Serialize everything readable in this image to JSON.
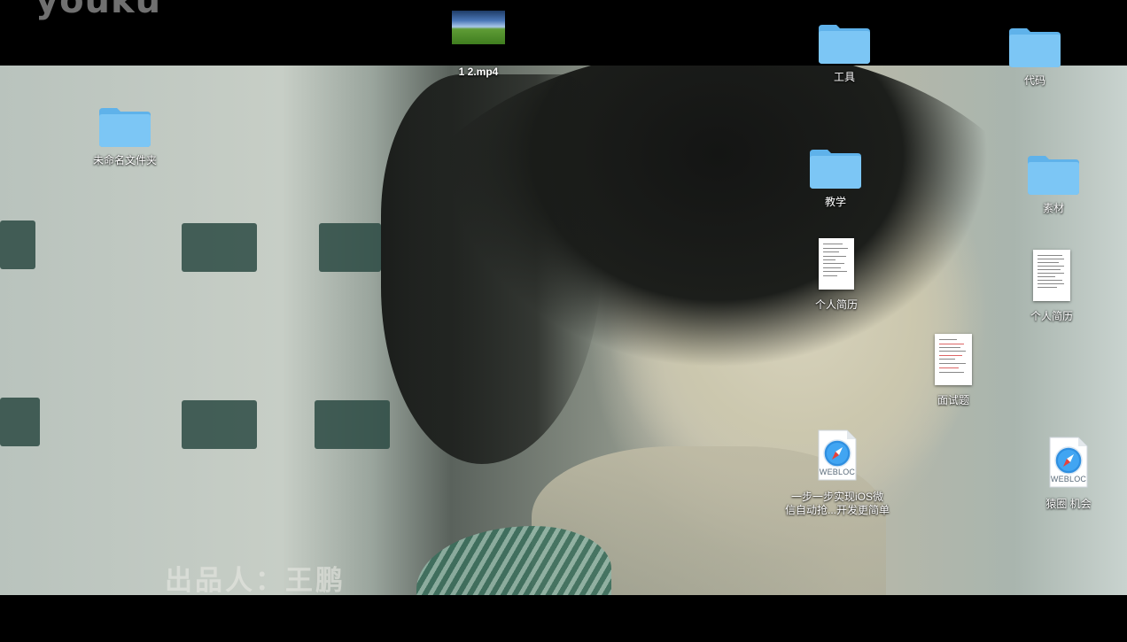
{
  "wallpaper": {
    "watermark": "youku",
    "credit_text": "出品人：王鹏"
  },
  "colors": {
    "folder_body": "#7cc6f5",
    "folder_tab": "#5fb2ea",
    "label_text": "#ffffff",
    "letterbox": "#000000"
  },
  "icons": {
    "video": {
      "label": "1 2.mp4",
      "icon": "video-thumbnail-icon"
    },
    "folder_tools": {
      "label": "工具",
      "icon": "folder-icon"
    },
    "folder_code": {
      "label": "代码",
      "icon": "folder-icon"
    },
    "folder_untitled": {
      "label": "未命名文件夹",
      "icon": "folder-icon"
    },
    "folder_teaching": {
      "label": "教学",
      "icon": "folder-icon"
    },
    "folder_materials": {
      "label": "素材",
      "icon": "folder-icon"
    },
    "resume_1": {
      "label": "个人简历",
      "icon": "document-icon"
    },
    "resume_2": {
      "label": "个人简历",
      "icon": "document-icon"
    },
    "interview": {
      "label": "面试题",
      "icon": "document-icon"
    },
    "webloc_ios": {
      "label_line1": "一步一步实现iOS微",
      "label_line2": "信自动抢...开发更简单",
      "badge": "WEBLOC",
      "icon": "safari-compass-icon"
    },
    "webloc_jobs": {
      "label": "猿圈 机会",
      "badge": "WEBLOC",
      "icon": "safari-compass-icon"
    }
  }
}
